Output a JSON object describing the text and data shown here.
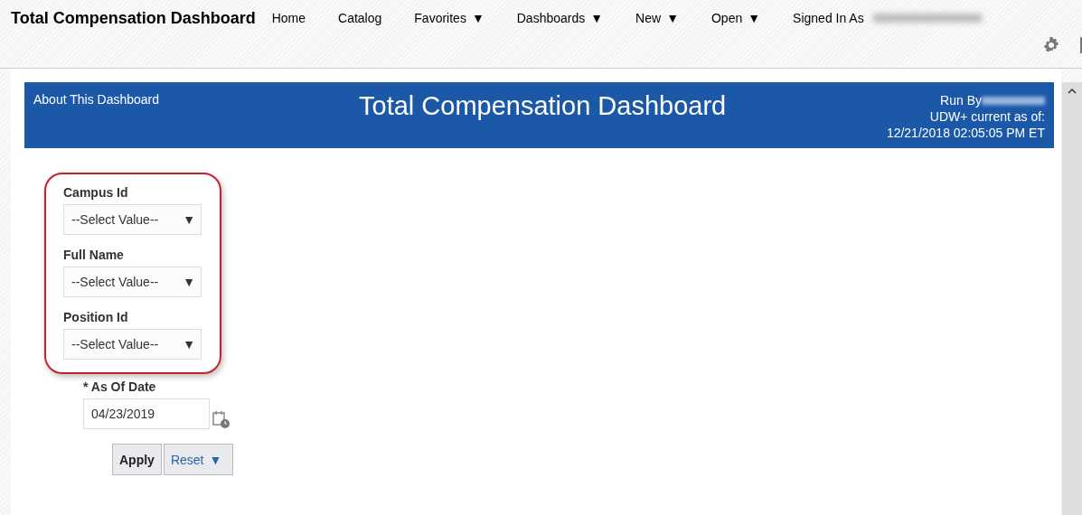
{
  "app_title": "Total Compensation Dashboard",
  "menu": [
    {
      "label": "Home"
    },
    {
      "label": "Catalog"
    },
    {
      "label": "Favorites",
      "caret": "▼"
    },
    {
      "label": "Dashboards",
      "caret": "▼"
    },
    {
      "label": "New",
      "caret": "▼"
    },
    {
      "label": "Open",
      "caret": "▼"
    }
  ],
  "signed_in_label": "Signed In As",
  "header": {
    "about_link": "About This Dashboard",
    "title": "Total Compensation Dashboard",
    "run_by": "Run By",
    "current_as_of": "UDW+ current as of:",
    "timestamp": "12/21/2018 02:05:05 PM ET"
  },
  "highlighted_prompts": [
    {
      "label": "Campus Id",
      "placeholder": "--Select Value--",
      "caret": "▼"
    },
    {
      "label": "Full Name",
      "placeholder": "--Select Value--",
      "caret": "▼"
    },
    {
      "label": "Position Id",
      "placeholder": "--Select Value--",
      "caret": "▼"
    }
  ],
  "date_prompt": {
    "label": "* As Of Date",
    "value": "04/23/2019"
  },
  "buttons": [
    {
      "label": "Apply",
      "kind": "primary"
    },
    {
      "label": "Reset",
      "caret": "▼",
      "kind": "link"
    }
  ]
}
